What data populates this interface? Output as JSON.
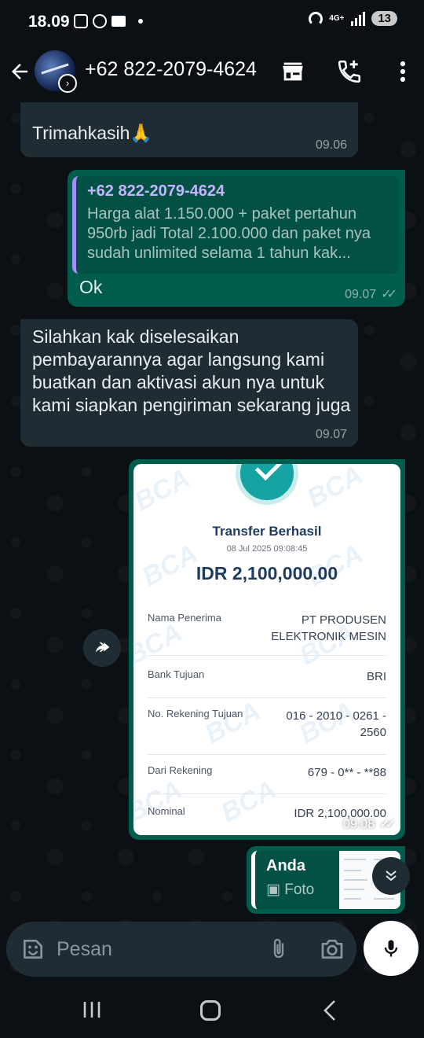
{
  "status_bar": {
    "time": "18.09",
    "network": "4G+",
    "battery": "13"
  },
  "header": {
    "contact": "+62 822-2079-4624"
  },
  "messages": [
    {
      "type": "incoming",
      "text": "Trimahkasih🙏",
      "time": "09.06"
    },
    {
      "type": "outgoing",
      "quote_author": "+62 822-2079-4624",
      "quote_text": "Harga alat 1.150.000 + paket pertahun 950rb jadi Total 2.100.000 dan paket nya sudah unlimited selama 1 tahun kak...",
      "text": "Ok",
      "time": "09.07",
      "status": "read"
    },
    {
      "type": "incoming",
      "text": "Silahkan kak diselesaikan pembayarannya agar langsung kami buatkan dan aktivasi akun nya untuk kami siapkan pengiriman sekarang juga",
      "time": "09.07"
    },
    {
      "type": "outgoing-image",
      "time": "09.08",
      "status": "read",
      "receipt": {
        "watermark": "BCA",
        "title": "Transfer Berhasil",
        "datetime": "08 Jul 2025 09:08:45",
        "amount": "IDR 2,100,000.00",
        "rows": [
          {
            "label": "Nama Penerima",
            "value_line1": "PT PRODUSEN",
            "value_line2": "ELEKTRONIK MESIN"
          },
          {
            "label": "Bank Tujuan",
            "value_line1": "BRI",
            "value_line2": ""
          },
          {
            "label": "No. Rekening Tujuan",
            "value_line1": "016 - 2010 - 0261 -",
            "value_line2": "2560"
          },
          {
            "label": "Dari Rekening",
            "value_line1": "679 - 0** - **88",
            "value_line2": ""
          },
          {
            "label": "Nominal",
            "value_line1": "IDR 2,100,000.00",
            "value_line2": ""
          }
        ]
      }
    },
    {
      "type": "outgoing-reply",
      "quote_author": "Anda",
      "quote_text": "Foto"
    }
  ],
  "input": {
    "placeholder": "Pesan"
  },
  "colors": {
    "background": "#0b1014",
    "incoming_bubble": "#1f2c34",
    "outgoing_bubble": "#005c4b",
    "quote_accent": "#a78bfa",
    "receipt_teal": "#15a3a3",
    "receipt_navy": "#1e3a5f"
  },
  "icons": [
    "back-arrow-icon",
    "shop-icon",
    "add-call-icon",
    "more-vert-icon",
    "forward-icon",
    "scroll-down-icon",
    "emoji-icon",
    "attach-icon",
    "camera-icon",
    "mic-icon",
    "photo-icon"
  ]
}
